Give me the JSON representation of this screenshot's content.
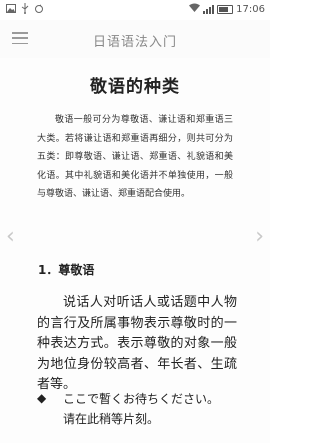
{
  "status_bar": {
    "time": "17:06",
    "left_icons": [
      "image-icon",
      "usb-icon",
      "sync-icon"
    ],
    "right_icons": [
      "wifi-icon",
      "signal-icon",
      "battery-icon"
    ]
  },
  "nav": {
    "title": "日语语法入门"
  },
  "article": {
    "title": "敬语的种类",
    "intro": "敬语一般可分为尊敬语、谦让语和郑重语三大类。若将谦让语和郑重语再细分，则共可分为五类：即尊敬语、谦让语、郑重语、礼貌语和美化语。其中礼貌语和美化语并不单独使用，一般与尊敬语、谦让语、郑重语配合使用。",
    "section_title": "1．尊敬语",
    "body": "说话人对听话人或话题中人物的言行及所属事物表示尊敬时的一种表达方式。表示尊敬的对象一般为地位身份较高者、年长者、生疏者等。",
    "example_bullet": "◆",
    "example_jp": "ここで暫くお待ちください。",
    "example_cn": "请在此稍等片刻。"
  },
  "controls": {
    "prev_arrow": "‹",
    "next_arrow": "›"
  }
}
